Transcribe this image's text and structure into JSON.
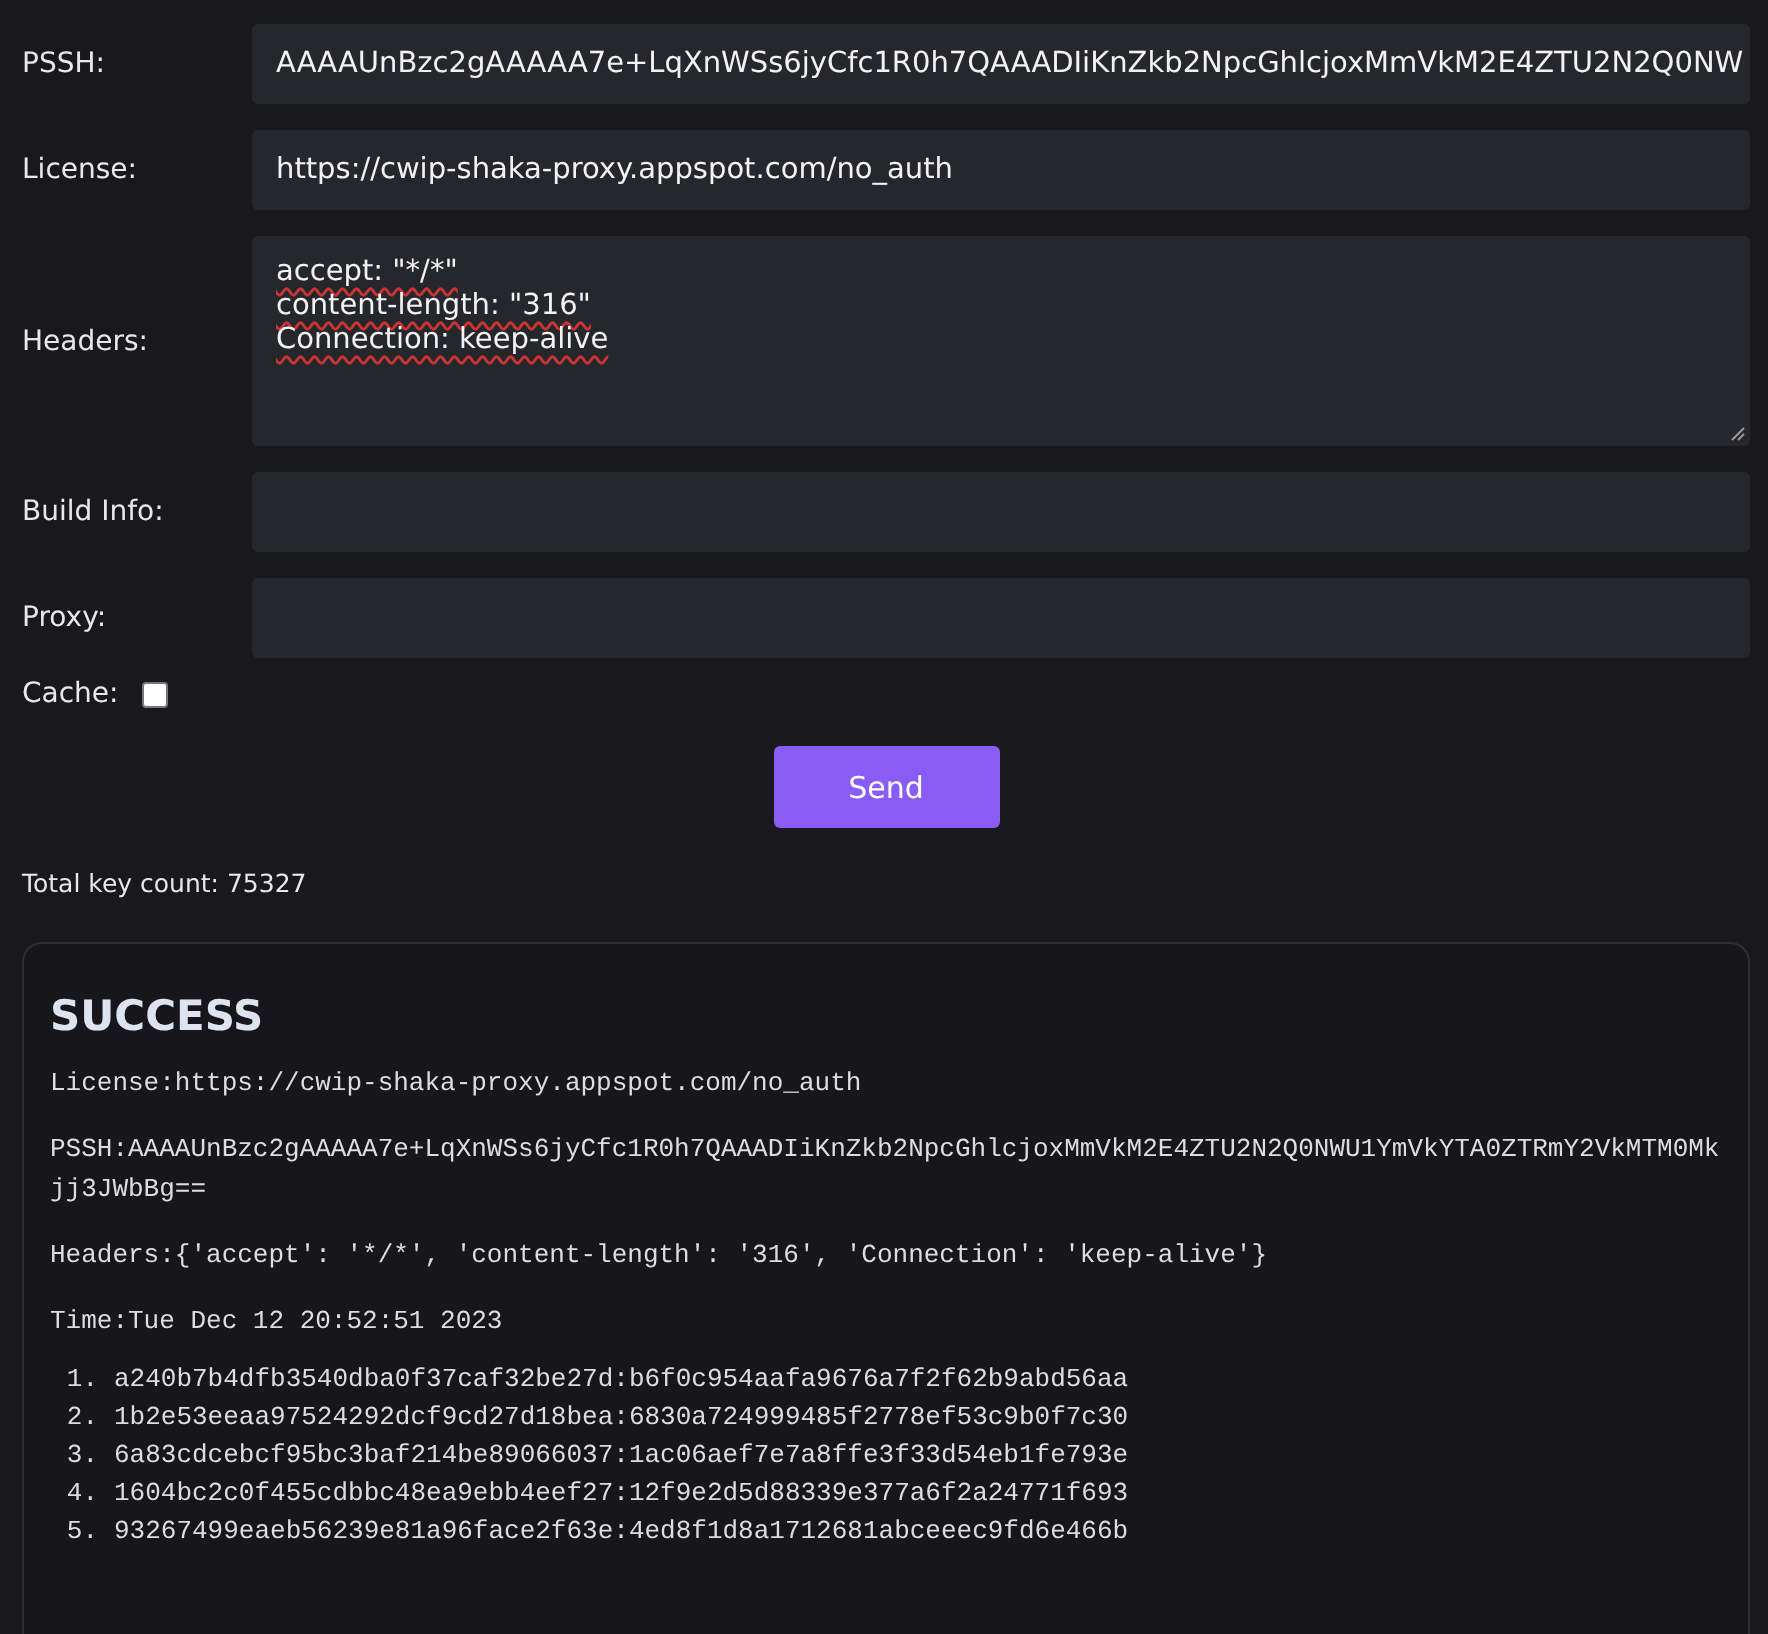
{
  "form": {
    "fields": [
      {
        "kind": "input",
        "label": "PSSH:",
        "value": "AAAAUnBzc2gAAAAA7e+LqXnWSs6jyCfc1R0h7QAAADIiKnZkb2NpcGhlcjoxMmVkM2E4ZTU2N2Q0NW"
      },
      {
        "kind": "input",
        "label": "License:",
        "value": "https://cwip-shaka-proxy.appspot.com/no_auth"
      },
      {
        "kind": "textarea",
        "label": "Headers:",
        "lines": [
          "accept: \"*/*\"",
          "content-length: \"316\"",
          "Connection: keep-alive"
        ]
      },
      {
        "kind": "input",
        "label": "Build Info:"
      },
      {
        "kind": "input",
        "label": "Proxy:"
      }
    ],
    "cache": {
      "label": "Cache:",
      "checked": false
    },
    "send_button": "Send"
  },
  "total_key_count": "Total key count: 75327",
  "result": {
    "title": "SUCCESS",
    "lines": [
      "License:https://cwip-shaka-proxy.appspot.com/no_auth",
      "PSSH:AAAAUnBzc2gAAAAA7e+LqXnWSs6jyCfc1R0h7QAAADIiKnZkb2NpcGhlcjoxMmVkM2E4ZTU2N2Q0NWU1YmVkYTA0ZTRmY2VkMTM0Mkjj3JWbBg==",
      "Headers:{'accept': '*/*', 'content-length': '316', 'Connection': 'keep-alive'}",
      "Time:Tue Dec 12 20:52:51 2023"
    ],
    "keys": [
      {
        "number": "1.",
        "key": "a240b7b4dfb3540dba0f37caf32be27d:b6f0c954aafa9676a7f2f62b9abd56aa"
      },
      {
        "number": "2.",
        "key": "1b2e53eeaa97524292dcf9cd27d18bea:6830a724999485f2778ef53c9b0f7c30"
      },
      {
        "number": "3.",
        "key": "6a83cdcebcf95bc3baf214be89066037:1ac06aef7e7a8ffe3f33d54eb1fe793e"
      },
      {
        "number": "4.",
        "key": "1604bc2c0f455cdbbc48ea9ebb4eef27:12f9e2d5d88339e377a6f2a24771f693"
      },
      {
        "number": "5.",
        "key": "93267499eaeb56239e81a96face2f63e:4ed8f1d8a1712681abceeec9fd6e466b"
      }
    ]
  }
}
